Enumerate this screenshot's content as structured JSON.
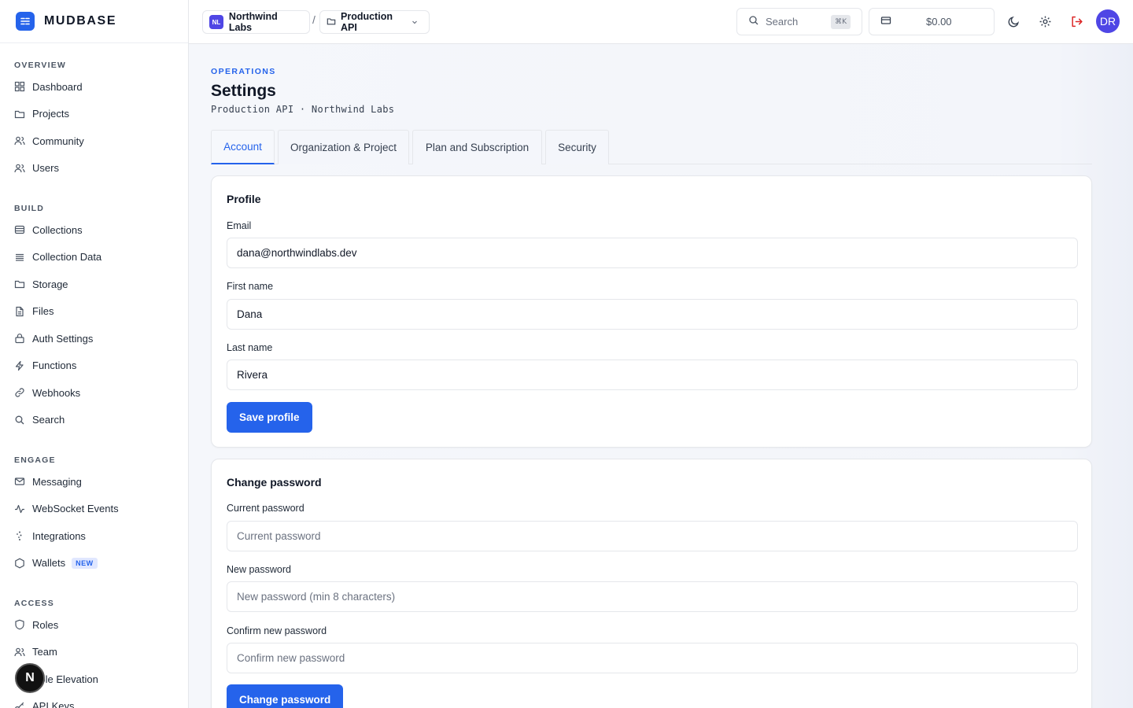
{
  "app": {
    "brand_name": "MUDBASE",
    "brand_icon": "dashboard-logo-icon",
    "accent_color": "#2563eb"
  },
  "sidebar": {
    "sections": [
      {
        "title": "OVERVIEW",
        "items": [
          {
            "label": "Dashboard",
            "icon": "grid-icon"
          },
          {
            "label": "Projects",
            "icon": "folder-icon"
          },
          {
            "label": "Community",
            "icon": "users-icon"
          },
          {
            "label": "Users",
            "icon": "users-icon"
          }
        ]
      },
      {
        "title": "BUILD",
        "items": [
          {
            "label": "Collections",
            "icon": "database-icon"
          },
          {
            "label": "Collection Data",
            "icon": "list-icon"
          },
          {
            "label": "Storage",
            "icon": "folder-icon"
          },
          {
            "label": "Files",
            "icon": "file-icon"
          },
          {
            "label": "Auth Settings",
            "icon": "lock-icon"
          },
          {
            "label": "Functions",
            "icon": "bolt-icon"
          },
          {
            "label": "Webhooks",
            "icon": "link-icon"
          },
          {
            "label": "Search",
            "icon": "search-icon"
          }
        ]
      },
      {
        "title": "ENGAGE",
        "items": [
          {
            "label": "Messaging",
            "icon": "mail-icon"
          },
          {
            "label": "WebSocket Events",
            "icon": "activity-icon"
          },
          {
            "label": "Integrations",
            "icon": "sparkle-icon"
          },
          {
            "label": "Wallets",
            "icon": "hexagon-icon",
            "badge": "NEW"
          }
        ]
      },
      {
        "title": "ACCESS",
        "items": [
          {
            "label": "Roles",
            "icon": "shield-icon"
          },
          {
            "label": "Team",
            "icon": "users-icon"
          },
          {
            "label": "Role Elevation",
            "icon": "shield-icon"
          },
          {
            "label": "API Keys",
            "icon": "key-icon"
          }
        ]
      }
    ],
    "floating_badge": "N"
  },
  "topbar": {
    "org_initials": "NL",
    "org_name": "Northwind Labs",
    "separator": "/",
    "project_name": "Production API",
    "search_label": "Search",
    "search_shortcut": "⌘K",
    "balance": "$0.00",
    "avatar_initials": "DR"
  },
  "page": {
    "eyebrow": "OPERATIONS",
    "title": "Settings",
    "subtitle": "Production API · Northwind Labs",
    "tabs": [
      {
        "label": "Account",
        "active": true
      },
      {
        "label": "Organization & Project",
        "active": false
      },
      {
        "label": "Plan and Subscription",
        "active": false
      },
      {
        "label": "Security",
        "active": false
      }
    ]
  },
  "profile": {
    "title": "Profile",
    "email_label": "Email",
    "email_value": "dana@northwindlabs.dev",
    "first_name_label": "First name",
    "first_name_value": "Dana",
    "last_name_label": "Last name",
    "last_name_value": "Rivera",
    "save_label": "Save profile"
  },
  "password": {
    "title": "Change password",
    "current_label": "Current password",
    "current_placeholder": "Current password",
    "new_label": "New password",
    "new_placeholder": "New password (min 8 characters)",
    "confirm_label": "Confirm new password",
    "confirm_placeholder": "Confirm new password",
    "submit_label": "Change password"
  }
}
